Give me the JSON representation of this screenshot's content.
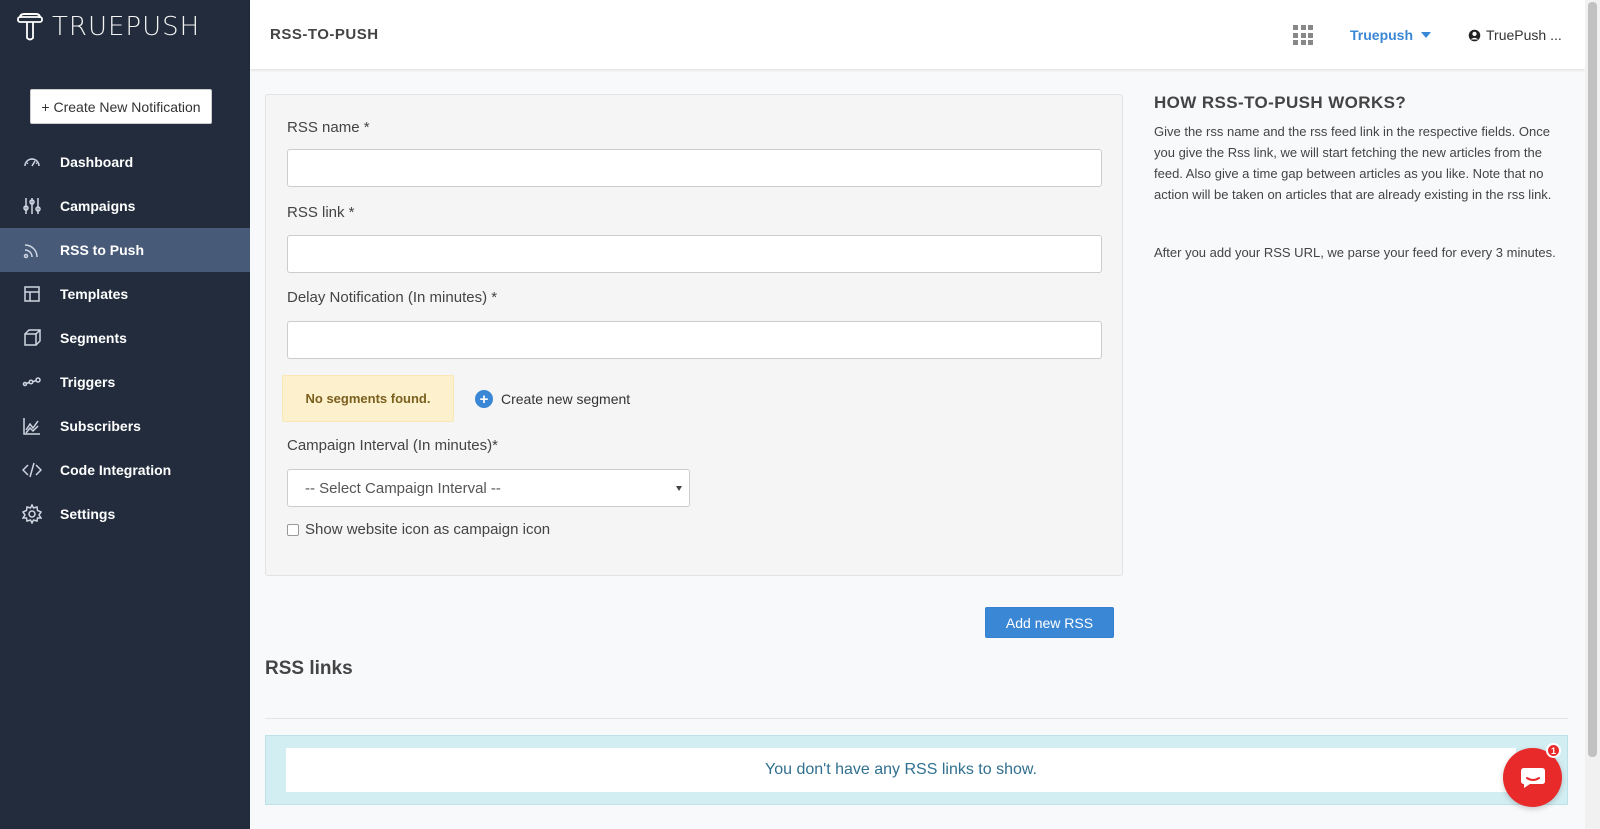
{
  "app": {
    "logo_text": "TRUEPUSH"
  },
  "sidebar": {
    "create_button": "+ Create New Notification",
    "items": [
      {
        "label": "Dashboard",
        "icon": "dashboard-icon"
      },
      {
        "label": "Campaigns",
        "icon": "sliders-icon"
      },
      {
        "label": "RSS to Push",
        "icon": "rss-icon",
        "active": true
      },
      {
        "label": "Templates",
        "icon": "template-icon"
      },
      {
        "label": "Segments",
        "icon": "cube-icon"
      },
      {
        "label": "Triggers",
        "icon": "triggers-icon"
      },
      {
        "label": "Subscribers",
        "icon": "chart-icon"
      },
      {
        "label": "Code Integration",
        "icon": "code-icon"
      },
      {
        "label": "Settings",
        "icon": "gear-icon"
      }
    ]
  },
  "header": {
    "title": "RSS-TO-PUSH",
    "brand_dropdown": "Truepush",
    "user_dropdown": "TruePush ..."
  },
  "form": {
    "rss_name_label": "RSS name *",
    "rss_link_label": "RSS link *",
    "delay_label": "Delay Notification (In minutes) *",
    "no_segments": "No segments found.",
    "create_segment": "Create new segment",
    "campaign_interval_label": "Campaign Interval (In minutes)*",
    "campaign_interval_value": "-- Select Campaign Interval --",
    "show_icon_label": "Show website icon as campaign icon"
  },
  "help": {
    "title": "HOW RSS-TO-PUSH WORKS?",
    "p1": "Give the rss name and the rss feed link in the respective fields. Once you give the Rss link, we will start fetching the new articles from the feed. Also give a time gap between articles as you like. Note that no action will be taken on articles that are already existing in the rss link.",
    "p2": "After you add your RSS URL, we parse your feed for every 3 minutes."
  },
  "actions": {
    "add_rss": "Add new RSS"
  },
  "rss_links": {
    "heading": "RSS links",
    "empty_message": "You don't have any RSS links to show."
  },
  "chat": {
    "badge_count": "1"
  },
  "colors": {
    "sidebar_bg": "#222c3c",
    "active_item": "#475a78",
    "accent": "#3a87d6"
  }
}
